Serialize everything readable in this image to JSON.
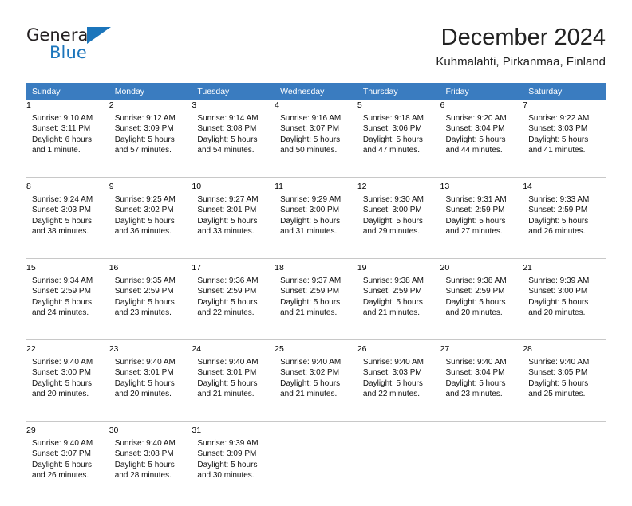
{
  "branding": {
    "name_top": "General",
    "name_bottom": "Blue",
    "triangle_icon": "triangle-icon",
    "accent_color": "#1b75bb"
  },
  "header": {
    "title": "December 2024",
    "subtitle": "Kuhmalahti, Pirkanmaa, Finland"
  },
  "calendar": {
    "header_bg": "#3a7cc0",
    "daynum_bg": "#f0f0f0",
    "weekday_headers": [
      "Sunday",
      "Monday",
      "Tuesday",
      "Wednesday",
      "Thursday",
      "Friday",
      "Saturday"
    ],
    "weeks": [
      [
        {
          "day": "1",
          "sunrise": "Sunrise: 9:10 AM",
          "sunset": "Sunset: 3:11 PM",
          "daylight1": "Daylight: 6 hours",
          "daylight2": "and 1 minute."
        },
        {
          "day": "2",
          "sunrise": "Sunrise: 9:12 AM",
          "sunset": "Sunset: 3:09 PM",
          "daylight1": "Daylight: 5 hours",
          "daylight2": "and 57 minutes."
        },
        {
          "day": "3",
          "sunrise": "Sunrise: 9:14 AM",
          "sunset": "Sunset: 3:08 PM",
          "daylight1": "Daylight: 5 hours",
          "daylight2": "and 54 minutes."
        },
        {
          "day": "4",
          "sunrise": "Sunrise: 9:16 AM",
          "sunset": "Sunset: 3:07 PM",
          "daylight1": "Daylight: 5 hours",
          "daylight2": "and 50 minutes."
        },
        {
          "day": "5",
          "sunrise": "Sunrise: 9:18 AM",
          "sunset": "Sunset: 3:06 PM",
          "daylight1": "Daylight: 5 hours",
          "daylight2": "and 47 minutes."
        },
        {
          "day": "6",
          "sunrise": "Sunrise: 9:20 AM",
          "sunset": "Sunset: 3:04 PM",
          "daylight1": "Daylight: 5 hours",
          "daylight2": "and 44 minutes."
        },
        {
          "day": "7",
          "sunrise": "Sunrise: 9:22 AM",
          "sunset": "Sunset: 3:03 PM",
          "daylight1": "Daylight: 5 hours",
          "daylight2": "and 41 minutes."
        }
      ],
      [
        {
          "day": "8",
          "sunrise": "Sunrise: 9:24 AM",
          "sunset": "Sunset: 3:03 PM",
          "daylight1": "Daylight: 5 hours",
          "daylight2": "and 38 minutes."
        },
        {
          "day": "9",
          "sunrise": "Sunrise: 9:25 AM",
          "sunset": "Sunset: 3:02 PM",
          "daylight1": "Daylight: 5 hours",
          "daylight2": "and 36 minutes."
        },
        {
          "day": "10",
          "sunrise": "Sunrise: 9:27 AM",
          "sunset": "Sunset: 3:01 PM",
          "daylight1": "Daylight: 5 hours",
          "daylight2": "and 33 minutes."
        },
        {
          "day": "11",
          "sunrise": "Sunrise: 9:29 AM",
          "sunset": "Sunset: 3:00 PM",
          "daylight1": "Daylight: 5 hours",
          "daylight2": "and 31 minutes."
        },
        {
          "day": "12",
          "sunrise": "Sunrise: 9:30 AM",
          "sunset": "Sunset: 3:00 PM",
          "daylight1": "Daylight: 5 hours",
          "daylight2": "and 29 minutes."
        },
        {
          "day": "13",
          "sunrise": "Sunrise: 9:31 AM",
          "sunset": "Sunset: 2:59 PM",
          "daylight1": "Daylight: 5 hours",
          "daylight2": "and 27 minutes."
        },
        {
          "day": "14",
          "sunrise": "Sunrise: 9:33 AM",
          "sunset": "Sunset: 2:59 PM",
          "daylight1": "Daylight: 5 hours",
          "daylight2": "and 26 minutes."
        }
      ],
      [
        {
          "day": "15",
          "sunrise": "Sunrise: 9:34 AM",
          "sunset": "Sunset: 2:59 PM",
          "daylight1": "Daylight: 5 hours",
          "daylight2": "and 24 minutes."
        },
        {
          "day": "16",
          "sunrise": "Sunrise: 9:35 AM",
          "sunset": "Sunset: 2:59 PM",
          "daylight1": "Daylight: 5 hours",
          "daylight2": "and 23 minutes."
        },
        {
          "day": "17",
          "sunrise": "Sunrise: 9:36 AM",
          "sunset": "Sunset: 2:59 PM",
          "daylight1": "Daylight: 5 hours",
          "daylight2": "and 22 minutes."
        },
        {
          "day": "18",
          "sunrise": "Sunrise: 9:37 AM",
          "sunset": "Sunset: 2:59 PM",
          "daylight1": "Daylight: 5 hours",
          "daylight2": "and 21 minutes."
        },
        {
          "day": "19",
          "sunrise": "Sunrise: 9:38 AM",
          "sunset": "Sunset: 2:59 PM",
          "daylight1": "Daylight: 5 hours",
          "daylight2": "and 21 minutes."
        },
        {
          "day": "20",
          "sunrise": "Sunrise: 9:38 AM",
          "sunset": "Sunset: 2:59 PM",
          "daylight1": "Daylight: 5 hours",
          "daylight2": "and 20 minutes."
        },
        {
          "day": "21",
          "sunrise": "Sunrise: 9:39 AM",
          "sunset": "Sunset: 3:00 PM",
          "daylight1": "Daylight: 5 hours",
          "daylight2": "and 20 minutes."
        }
      ],
      [
        {
          "day": "22",
          "sunrise": "Sunrise: 9:40 AM",
          "sunset": "Sunset: 3:00 PM",
          "daylight1": "Daylight: 5 hours",
          "daylight2": "and 20 minutes."
        },
        {
          "day": "23",
          "sunrise": "Sunrise: 9:40 AM",
          "sunset": "Sunset: 3:01 PM",
          "daylight1": "Daylight: 5 hours",
          "daylight2": "and 20 minutes."
        },
        {
          "day": "24",
          "sunrise": "Sunrise: 9:40 AM",
          "sunset": "Sunset: 3:01 PM",
          "daylight1": "Daylight: 5 hours",
          "daylight2": "and 21 minutes."
        },
        {
          "day": "25",
          "sunrise": "Sunrise: 9:40 AM",
          "sunset": "Sunset: 3:02 PM",
          "daylight1": "Daylight: 5 hours",
          "daylight2": "and 21 minutes."
        },
        {
          "day": "26",
          "sunrise": "Sunrise: 9:40 AM",
          "sunset": "Sunset: 3:03 PM",
          "daylight1": "Daylight: 5 hours",
          "daylight2": "and 22 minutes."
        },
        {
          "day": "27",
          "sunrise": "Sunrise: 9:40 AM",
          "sunset": "Sunset: 3:04 PM",
          "daylight1": "Daylight: 5 hours",
          "daylight2": "and 23 minutes."
        },
        {
          "day": "28",
          "sunrise": "Sunrise: 9:40 AM",
          "sunset": "Sunset: 3:05 PM",
          "daylight1": "Daylight: 5 hours",
          "daylight2": "and 25 minutes."
        }
      ],
      [
        {
          "day": "29",
          "sunrise": "Sunrise: 9:40 AM",
          "sunset": "Sunset: 3:07 PM",
          "daylight1": "Daylight: 5 hours",
          "daylight2": "and 26 minutes."
        },
        {
          "day": "30",
          "sunrise": "Sunrise: 9:40 AM",
          "sunset": "Sunset: 3:08 PM",
          "daylight1": "Daylight: 5 hours",
          "daylight2": "and 28 minutes."
        },
        {
          "day": "31",
          "sunrise": "Sunrise: 9:39 AM",
          "sunset": "Sunset: 3:09 PM",
          "daylight1": "Daylight: 5 hours",
          "daylight2": "and 30 minutes."
        },
        {
          "day": "",
          "sunrise": "",
          "sunset": "",
          "daylight1": "",
          "daylight2": ""
        },
        {
          "day": "",
          "sunrise": "",
          "sunset": "",
          "daylight1": "",
          "daylight2": ""
        },
        {
          "day": "",
          "sunrise": "",
          "sunset": "",
          "daylight1": "",
          "daylight2": ""
        },
        {
          "day": "",
          "sunrise": "",
          "sunset": "",
          "daylight1": "",
          "daylight2": ""
        }
      ]
    ]
  }
}
